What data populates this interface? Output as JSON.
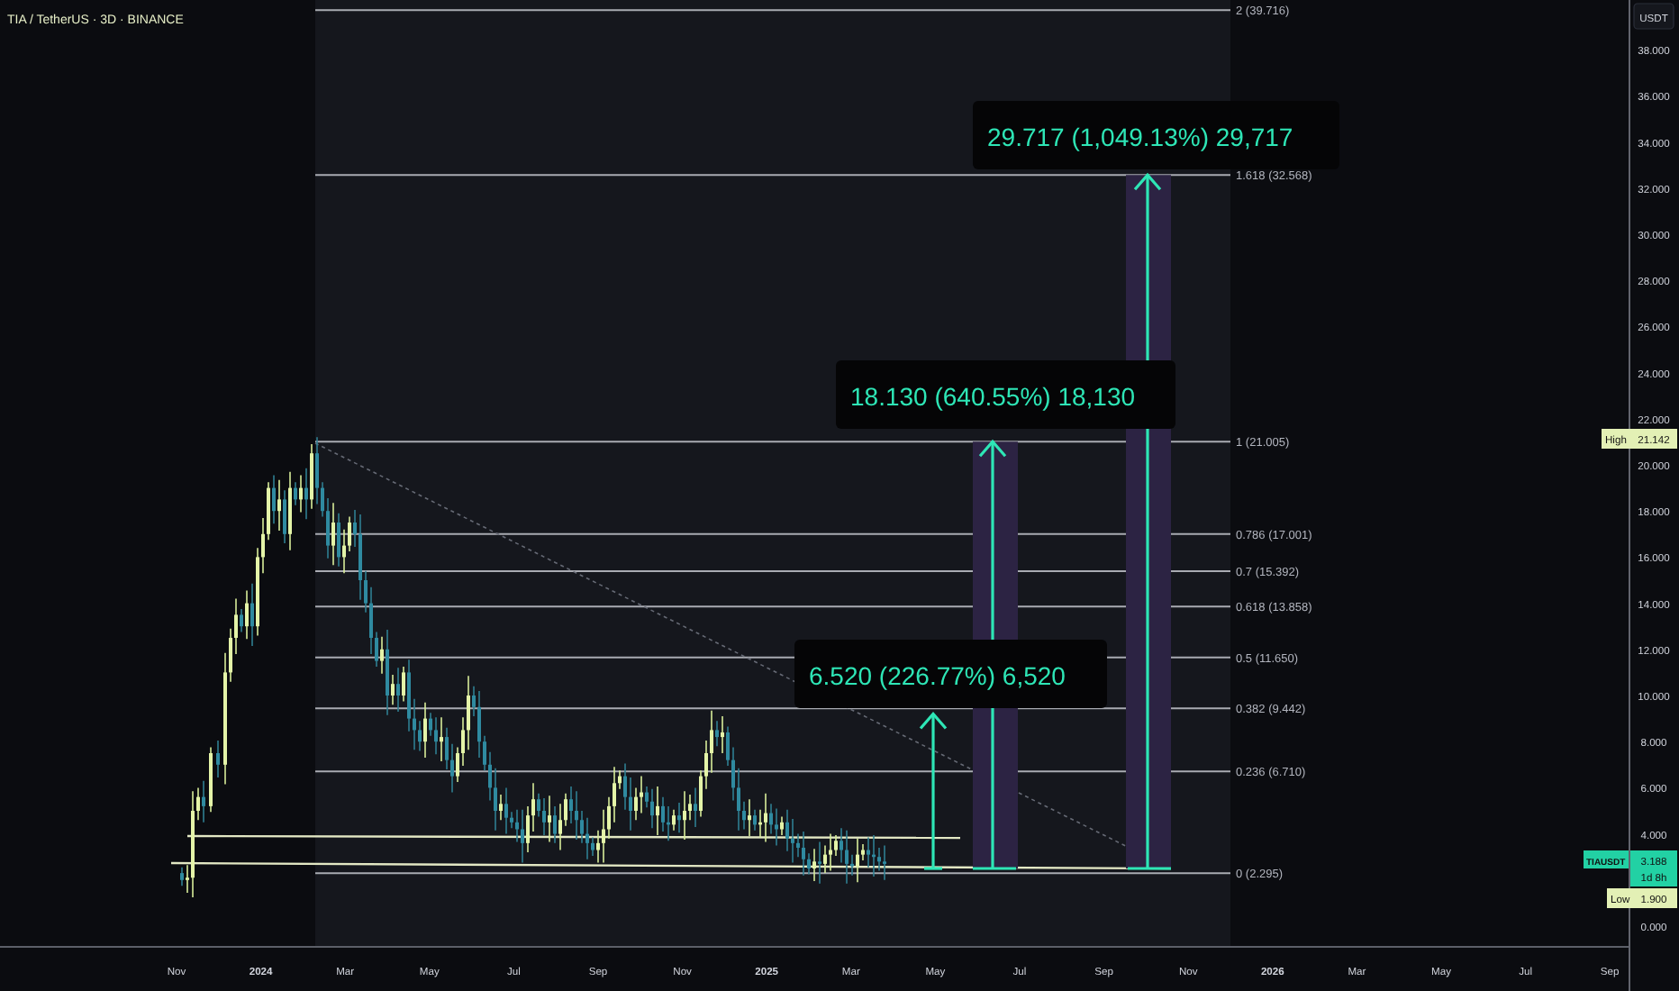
{
  "header": {
    "title": "TIA / TetherUS · 3D · BINANCE"
  },
  "price_axis": {
    "unit": "USDT",
    "labels": [
      "38.000",
      "36.000",
      "34.000",
      "32.000",
      "30.000",
      "28.000",
      "26.000",
      "24.000",
      "22.000",
      "20.000",
      "18.000",
      "16.000",
      "14.000",
      "12.000",
      "10.000",
      "8.000",
      "6.000",
      "4.000",
      "0.000"
    ]
  },
  "time_axis": {
    "labels": [
      {
        "text": "Nov",
        "kind": "month"
      },
      {
        "text": "2024",
        "kind": "year"
      },
      {
        "text": "Mar",
        "kind": "month"
      },
      {
        "text": "May",
        "kind": "month"
      },
      {
        "text": "Jul",
        "kind": "month"
      },
      {
        "text": "Sep",
        "kind": "month"
      },
      {
        "text": "Nov",
        "kind": "month"
      },
      {
        "text": "2025",
        "kind": "year"
      },
      {
        "text": "Mar",
        "kind": "month"
      },
      {
        "text": "May",
        "kind": "month"
      },
      {
        "text": "Jul",
        "kind": "month"
      },
      {
        "text": "Sep",
        "kind": "month"
      },
      {
        "text": "Nov",
        "kind": "month"
      },
      {
        "text": "2026",
        "kind": "year"
      },
      {
        "text": "Mar",
        "kind": "month"
      },
      {
        "text": "May",
        "kind": "month"
      },
      {
        "text": "Jul",
        "kind": "month"
      },
      {
        "text": "Sep",
        "kind": "month"
      }
    ]
  },
  "fib_levels": [
    {
      "label": "2 (39.716)"
    },
    {
      "label": "1.618 (32.568)"
    },
    {
      "label": "1 (21.005)"
    },
    {
      "label": "0.786 (17.001)"
    },
    {
      "label": "0.7 (15.392)"
    },
    {
      "label": "0.618 (13.858)"
    },
    {
      "label": "0.5 (11.650)"
    },
    {
      "label": "0.382 (9.442)"
    },
    {
      "label": "0.236 (6.710)"
    },
    {
      "label": "0 (2.295)"
    }
  ],
  "measurements": [
    {
      "label": "29.717 (1,049.13%) 29,717"
    },
    {
      "label": "18.130 (640.55%) 18,130"
    },
    {
      "label": "6.520 (226.77%) 6,520"
    }
  ],
  "badges": {
    "high": {
      "label": "High",
      "value": "21.142"
    },
    "symbol": {
      "label": "TIAUSDT",
      "value": "3.188",
      "countdown": "1d 8h"
    },
    "low": {
      "label": "Low",
      "value": "1.900"
    }
  }
}
